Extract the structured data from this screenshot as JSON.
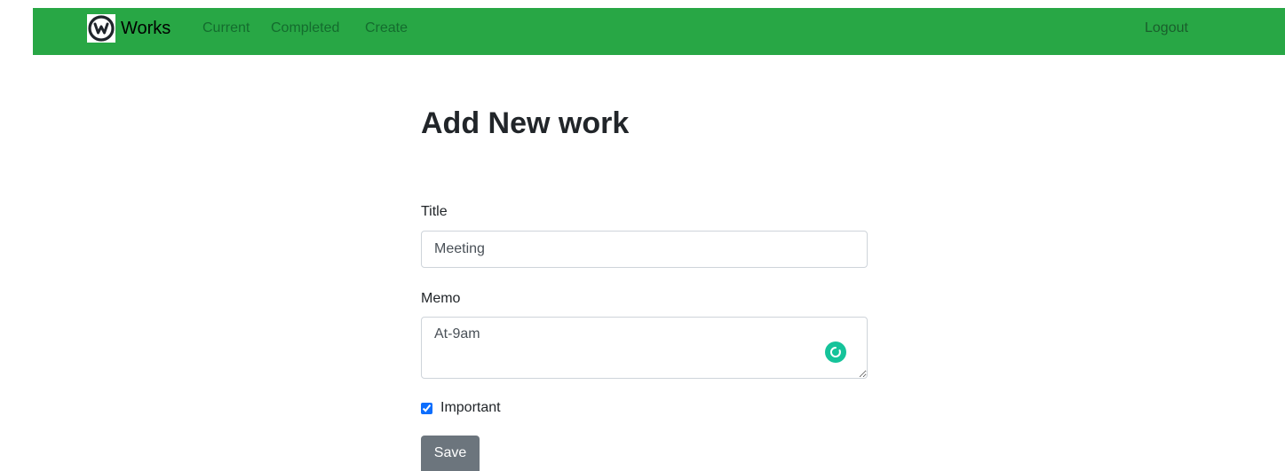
{
  "navbar": {
    "brand": "Works",
    "links": [
      "Current",
      "Completed",
      "Create"
    ],
    "logout": "Logout",
    "color": "#28a745"
  },
  "form": {
    "heading": "Add New work",
    "title_label": "Title",
    "title_value": "Meeting",
    "memo_label": "Memo",
    "memo_value": "At-9am",
    "important_label": "Important",
    "important_checked": true,
    "save_label": "Save"
  },
  "icons": {
    "brand": "workplace-logo-icon",
    "grammar": "grammarly-badge-icon"
  }
}
